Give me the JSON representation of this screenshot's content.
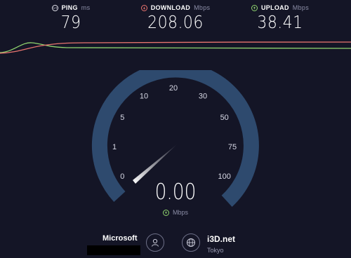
{
  "metrics": {
    "ping": {
      "label": "PING",
      "unit": "ms",
      "value": "79",
      "color": "#e6e6ef"
    },
    "download": {
      "label": "DOWNLOAD",
      "unit": "Mbps",
      "value": "208.06",
      "color": "#e8746f"
    },
    "upload": {
      "label": "UPLOAD",
      "unit": "Mbps",
      "value": "38.41",
      "color": "#8fd46e"
    }
  },
  "gauge": {
    "tick_labels": [
      "0",
      "1",
      "5",
      "10",
      "20",
      "30",
      "50",
      "75",
      "100"
    ],
    "reading": "0.00",
    "unit": "Mbps",
    "arc_color": "#2e4a6e"
  },
  "provider": {
    "name": "Microsoft",
    "icon": "user-icon"
  },
  "server": {
    "name": "i3D.net",
    "location": "Tokyo",
    "icon": "globe-icon"
  }
}
